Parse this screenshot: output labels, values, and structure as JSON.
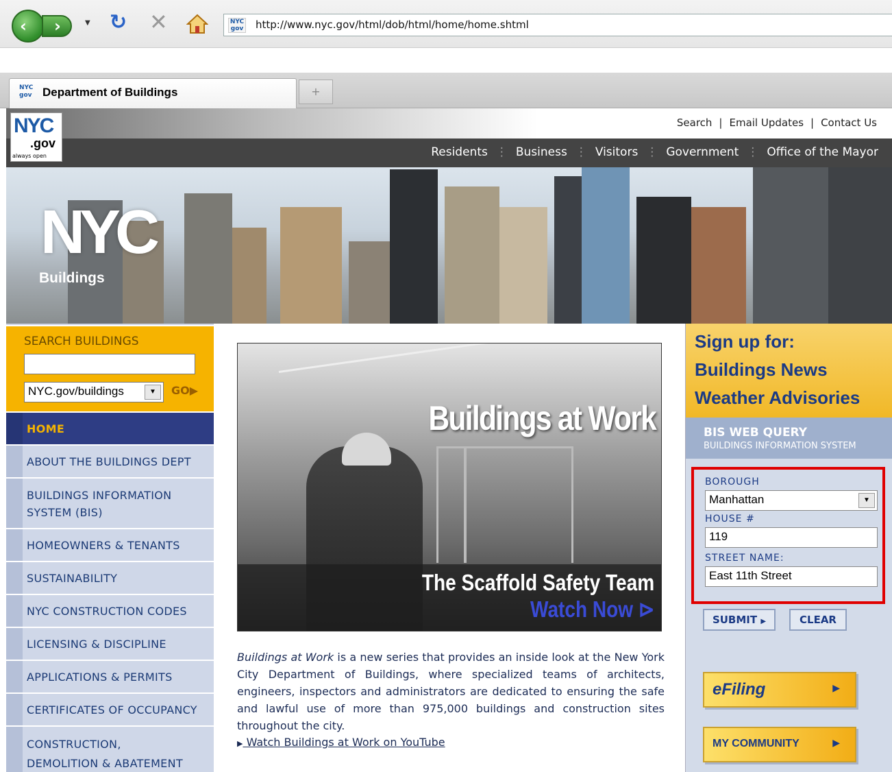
{
  "browser": {
    "url": "http://www.nyc.gov/html/dob/html/home/home.shtml",
    "tab_title": "Department of Buildings",
    "favicon_text": "NYC gov"
  },
  "header": {
    "logo_text": "NYC",
    "logo_sub": ".gov",
    "logo_tagline": "always open",
    "utility_links": [
      "Search",
      "Email Updates",
      "Contact Us"
    ],
    "main_nav": [
      "Residents",
      "Business",
      "Visitors",
      "Government",
      "Office of the Mayor"
    ],
    "banner_logo": "NYC",
    "banner_sub": "Buildings"
  },
  "search": {
    "label": "SEARCH BUILDINGS",
    "value": "",
    "scope": "NYC.gov/buildings",
    "go_label": "GO"
  },
  "leftnav": [
    "HOME",
    "ABOUT THE BUILDINGS DEPT",
    "BUILDINGS INFORMATION SYSTEM (BIS)",
    "HOMEOWNERS & TENANTS",
    "SUSTAINABILITY",
    "NYC CONSTRUCTION CODES",
    "LICENSING & DISCIPLINE",
    "APPLICATIONS & PERMITS",
    "CERTIFICATES OF OCCUPANCY",
    "CONSTRUCTION, DEMOLITION & ABATEMENT"
  ],
  "feature": {
    "headline": "Buildings at Work",
    "subhead": "The Scaffold Safety Team",
    "cta": "Watch Now",
    "desc_em": "Buildings at Work",
    "desc_rest": " is a new series that provides an inside look at the New York City Department of Buildings, where specialized teams of architects, engineers, inspectors and administrators are dedicated to ensuring the safe and lawful use of more than 975,000 buildings and construction sites throughout the city.",
    "link": "Watch Buildings at Work on YouTube"
  },
  "signup": {
    "title": "Sign up for:",
    "items": [
      "Buildings News",
      "Weather Advisories"
    ]
  },
  "bis": {
    "title": "BIS WEB QUERY",
    "subtitle": "BUILDINGS INFORMATION SYSTEM",
    "borough_label": "BOROUGH",
    "borough_value": "Manhattan",
    "house_label": "HOUSE #",
    "house_value": "119",
    "street_label": "STREET NAME:",
    "street_value": "East 11th Street",
    "submit": "SUBMIT",
    "clear": "CLEAR"
  },
  "promos": {
    "efiling": "eFiling",
    "community": "MY COMMUNITY"
  },
  "colors": {
    "nav_dark": "#444444",
    "accent_gold": "#f6b300",
    "link_blue": "#1b3a85",
    "highlight_red": "#e00000"
  }
}
